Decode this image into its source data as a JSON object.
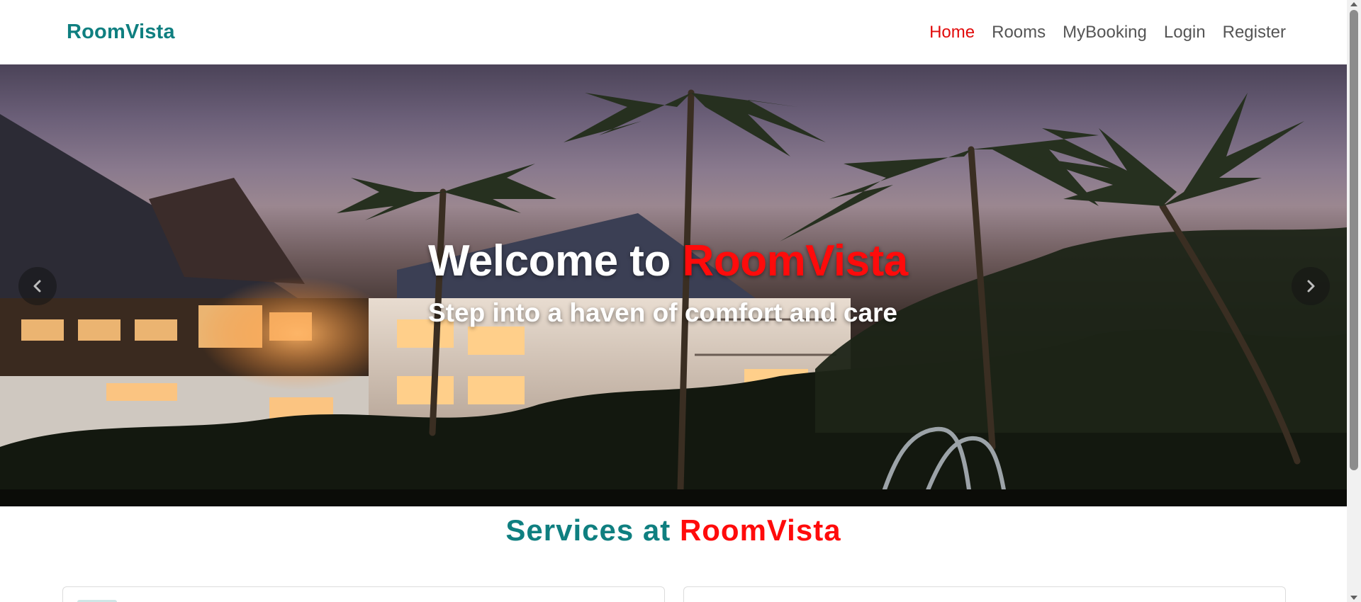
{
  "navbar": {
    "brand": "RoomVista",
    "links": [
      {
        "label": "Home",
        "active": true
      },
      {
        "label": "Rooms",
        "active": false
      },
      {
        "label": "MyBooking",
        "active": false
      },
      {
        "label": "Login",
        "active": false
      },
      {
        "label": "Register",
        "active": false
      }
    ]
  },
  "hero": {
    "title_prefix": "Welcome to ",
    "title_accent": "RoomVista",
    "subtitle": "Step into a haven of comfort and care",
    "prev_icon": "chevron-left-icon",
    "next_icon": "chevron-right-icon"
  },
  "services": {
    "title_prefix": "Services at ",
    "title_accent": "RoomVista"
  },
  "colors": {
    "brand": "#0f7f80",
    "accent": "#e10b0b",
    "nav_text": "#555555"
  }
}
